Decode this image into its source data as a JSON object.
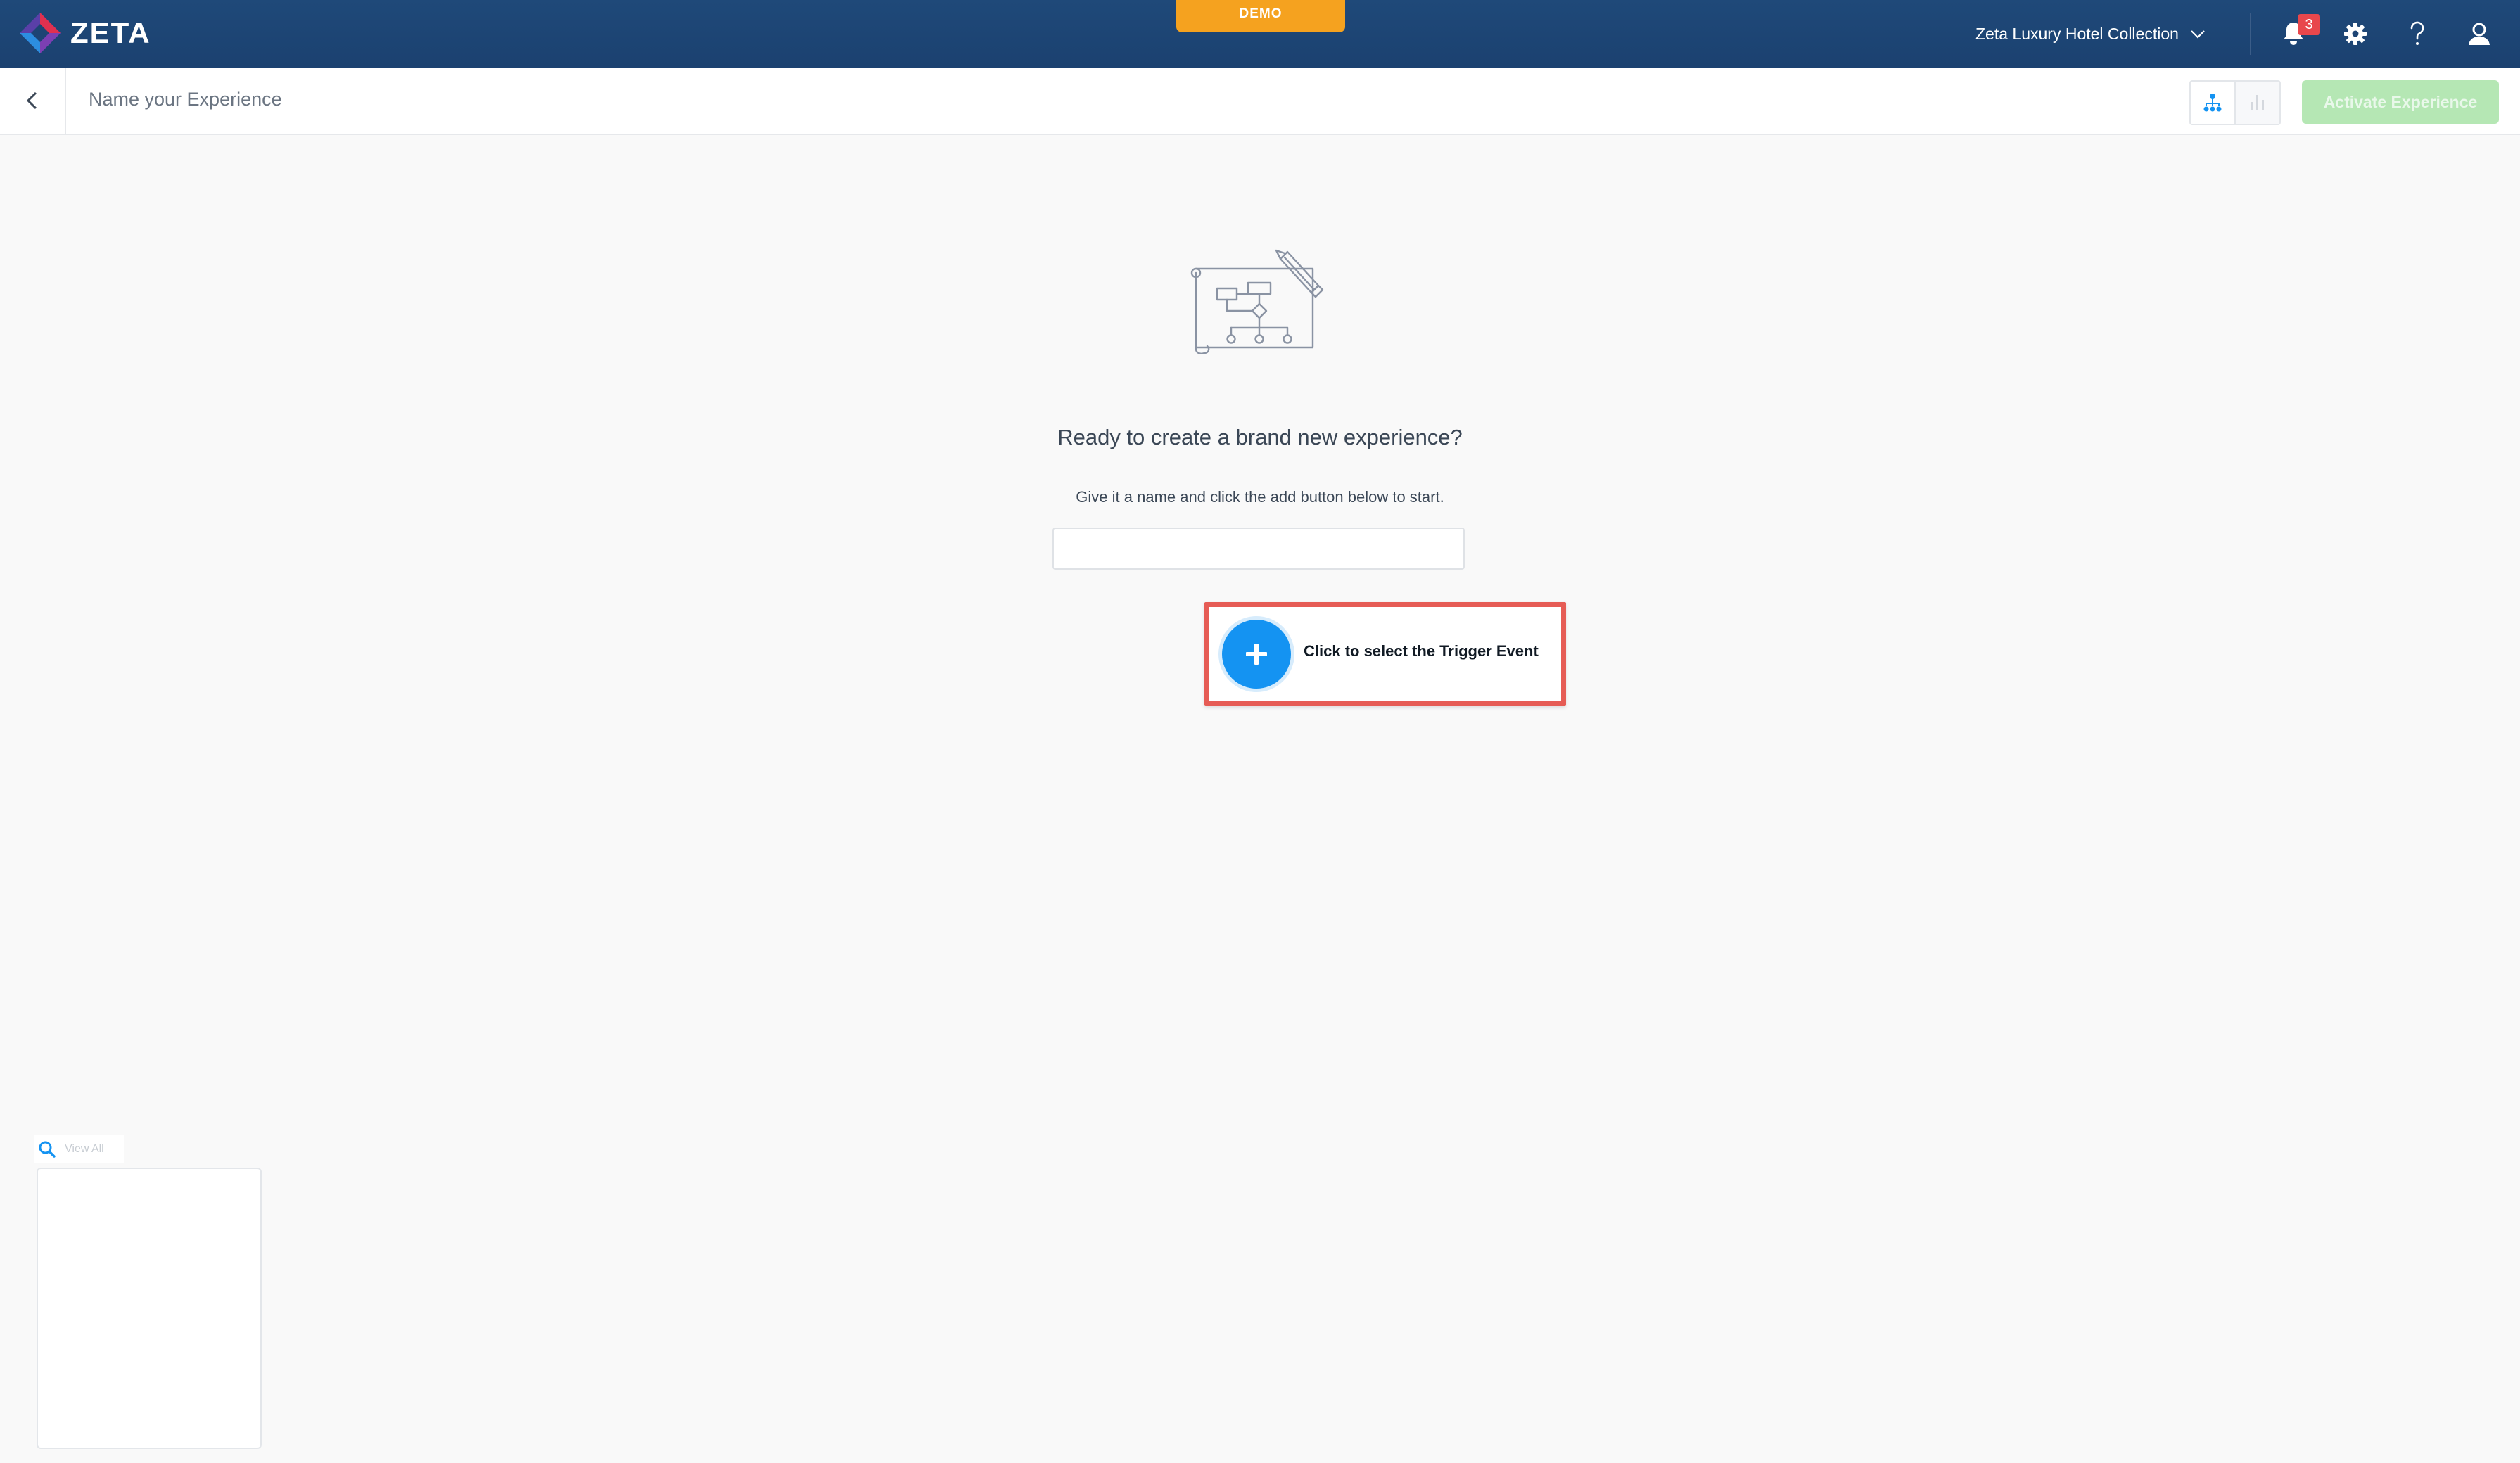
{
  "header": {
    "brand": "ZETA",
    "env_badge": "DEMO",
    "account_name": "Zeta Luxury Hotel Collection",
    "notification_count": "3",
    "icons": [
      "zeta-logo",
      "chevron-down-icon",
      "bell-icon",
      "gear-icon",
      "help-icon",
      "user-icon"
    ],
    "bar_color": "#1d4474",
    "badge_color": "#f5a21f"
  },
  "subheader": {
    "name_placeholder": "Name your Experience",
    "activate_label": "Activate Experience",
    "activate_color": "#b5e7b4",
    "icons": [
      "back-arrow-icon",
      "flow-view-icon",
      "stats-view-icon"
    ]
  },
  "main": {
    "illustration": "blueprint-pencil-illustration",
    "headline": "Ready to create a brand new experience?",
    "subline": "Give it a name and click the add button below to start.",
    "name_input_value": "",
    "trigger_label": "Click to select the Trigger Event",
    "add_button_color": "#1493f2",
    "highlight_color": "#e65c55"
  },
  "mini_widget": {
    "search_label": "View All"
  }
}
